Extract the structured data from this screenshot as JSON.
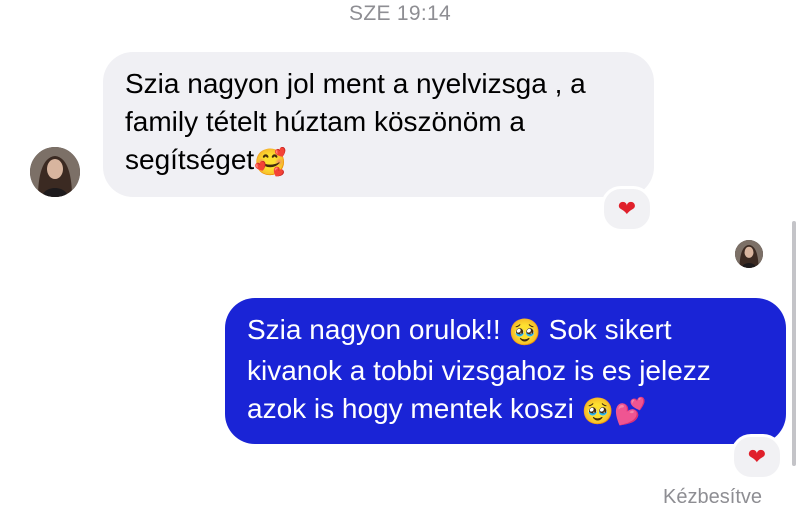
{
  "thread": {
    "timestamp": "SZE 19:14"
  },
  "incoming_message": {
    "lines": [
      "Szia nagyon jol ment a nyelvizsga , a",
      "family tételt húztam köszönöm a",
      "segítséget"
    ],
    "emoji": "🥰",
    "reaction": "❤"
  },
  "outgoing_message": {
    "lines": [
      "Szia nagyon orulok!! ",
      "kivanok a tobbi vizsgahoz is es jelezz",
      "azok is hogy mentek koszi "
    ],
    "line1_emoji": "🥹",
    "line1_tail": " Sok sikert",
    "line3_emoji_1": "🥹",
    "line3_emoji_2": "💕",
    "reaction": "❤"
  },
  "delivery_status": "Kézbesítve",
  "colors": {
    "outgoing_bubble": "#1a24d6",
    "incoming_bubble": "#f0f0f4",
    "heart": "#e0202b",
    "meta_text": "#8e8e93"
  },
  "icons": {
    "incoming_avatar": "avatar",
    "seen_avatar": "avatar",
    "reaction": "heart-icon"
  }
}
